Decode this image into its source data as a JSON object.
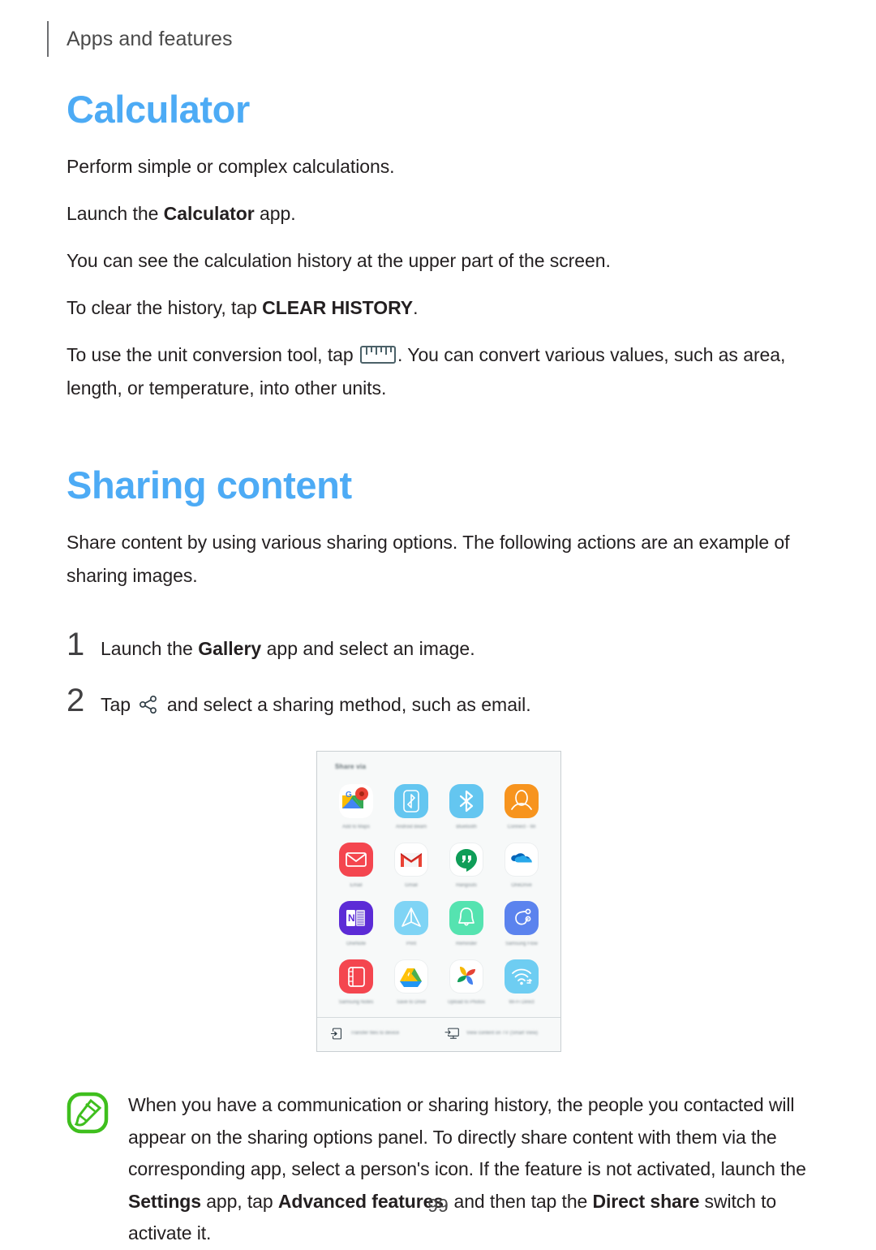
{
  "header": {
    "running_title": "Apps and features"
  },
  "sections": [
    {
      "title": "Calculator",
      "paragraphs": [
        "Perform simple or complex calculations.",
        "Launch the Calculator app.",
        "You can see the calculation history at the upper part of the screen.",
        "To clear the history, tap CLEAR HISTORY.",
        "To use the unit conversion tool, tap  . You can convert various values, such as area, length, or temperature, into other units."
      ],
      "p1_plain": "Perform simple or complex calculations.",
      "p2_pre": "Launch the ",
      "p2_bold": "Calculator",
      "p2_post": " app.",
      "p3_plain": "You can see the calculation history at the upper part of the screen.",
      "p4_pre": "To clear the history, tap ",
      "p4_bold": "CLEAR HISTORY",
      "p4_post": ".",
      "p5_pre": "To use the unit conversion tool, tap ",
      "p5_post": ". You can convert various values, such as area, length, or temperature, into other units."
    },
    {
      "title": "Sharing content",
      "intro": "Share content by using various sharing options. The following actions are an example of sharing images."
    }
  ],
  "steps": [
    {
      "number": "1",
      "pre": "Launch the ",
      "bold": "Gallery",
      "post": " app and select an image."
    },
    {
      "number": "2",
      "pre": "Tap ",
      "bold": "",
      "post": " and select a sharing method, such as email."
    }
  ],
  "share_dialog": {
    "title": "Share via",
    "apps": [
      {
        "label": "Add to Maps",
        "icon": "google-maps-icon",
        "bg": "#ffffff"
      },
      {
        "label": "Android Beam",
        "icon": "android-beam-icon",
        "bg": "#64c6f0"
      },
      {
        "label": "Bluetooth",
        "icon": "bluetooth-icon",
        "bg": "#64c6f0"
      },
      {
        "label": "Connect - Wi",
        "icon": "contacts-icon",
        "bg": "#f7941e"
      },
      {
        "label": "Email",
        "icon": "email-icon",
        "bg": "#f4464f"
      },
      {
        "label": "Gmail",
        "icon": "gmail-icon",
        "bg": "#ffffff"
      },
      {
        "label": "Hangouts",
        "icon": "hangouts-icon",
        "bg": "#ffffff"
      },
      {
        "label": "OneDrive",
        "icon": "onedrive-icon",
        "bg": "#ffffff"
      },
      {
        "label": "OneNote",
        "icon": "onenote-icon",
        "bg": "#5c2bd6"
      },
      {
        "label": "Print",
        "icon": "print-icon",
        "bg": "#7fd4f5"
      },
      {
        "label": "Reminder",
        "icon": "reminder-bell-icon",
        "bg": "#55e3b0"
      },
      {
        "label": "Samsung Flow",
        "icon": "samsung-flow-icon",
        "bg": "#5b83ee"
      },
      {
        "label": "Samsung Notes",
        "icon": "samsung-notes-icon",
        "bg": "#f4464f"
      },
      {
        "label": "Save to Drive",
        "icon": "google-drive-icon",
        "bg": "#ffffff"
      },
      {
        "label": "Upload to Photos",
        "icon": "google-photos-icon",
        "bg": "#ffffff"
      },
      {
        "label": "Wi-Fi Direct",
        "icon": "wifi-direct-icon",
        "bg": "#6ecdf2"
      }
    ],
    "footer": [
      {
        "label": "Transfer files to device",
        "icon": "transfer-files-icon"
      },
      {
        "label": "View content on TV (Smart View)",
        "icon": "smart-view-icon"
      }
    ]
  },
  "note": {
    "icon": "samsung-note-pencil-icon",
    "p1": "When you have a communication or sharing history, the people you contacted will appear on the sharing options panel. To directly share content with them via the corresponding app, select a person's icon. If the feature is not activated, launch the ",
    "b1": "Settings",
    "p2": " app, tap ",
    "b2": "Advanced features",
    "p3": ", and then tap the ",
    "b3": "Direct share",
    "p4": " switch to activate it."
  },
  "footer": {
    "page_number": "99"
  },
  "colors": {
    "heading_blue": "#4dabf5",
    "note_green": "#3fbf1e",
    "body_text": "#231f20"
  }
}
